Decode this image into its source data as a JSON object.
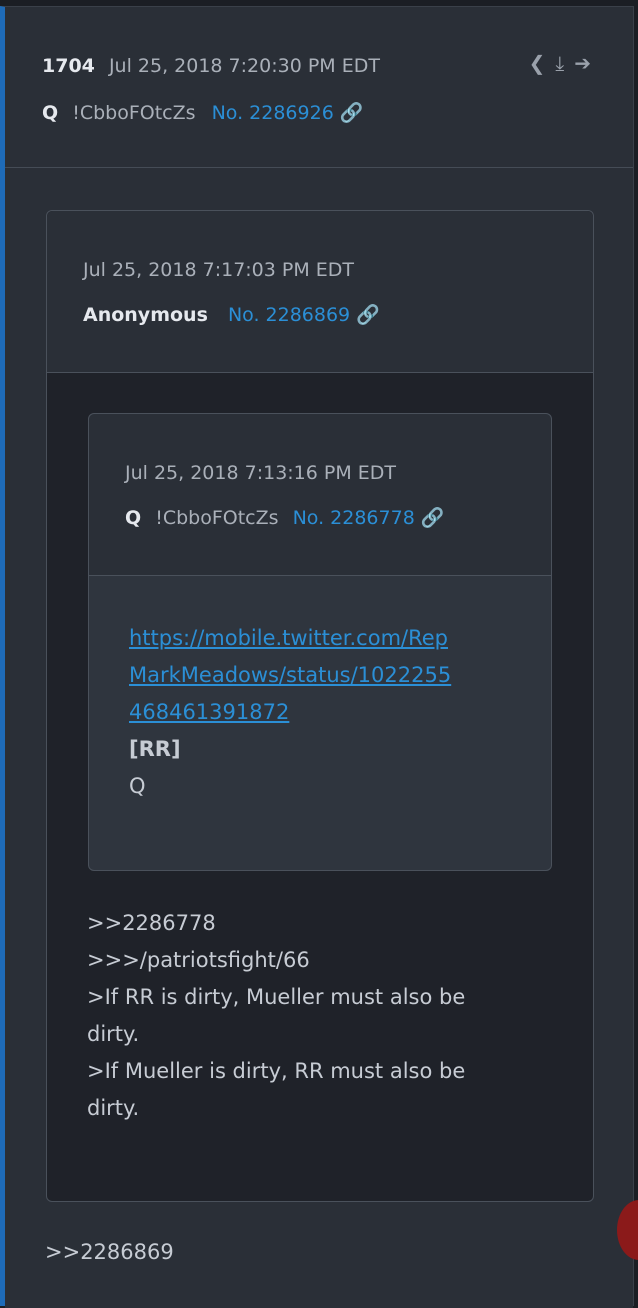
{
  "post": {
    "number": "1704",
    "date": "Jul 25, 2018 7:20:30 PM EDT",
    "name": "Q",
    "tripcode": "!CbboFOtcZs",
    "post_no": "No. 2286926",
    "body_text": ">>2286869"
  },
  "quote1": {
    "date": "Jul 25, 2018 7:17:03 PM EDT",
    "name": "Anonymous",
    "post_no": "No. 2286869",
    "lines": [
      ">>2286778",
      ">>>/patriotsfight/66",
      ">If RR is dirty, Mueller must also be",
      "dirty.",
      ">If Mueller is dirty, RR must also be",
      "dirty."
    ]
  },
  "quote2": {
    "date": "Jul 25, 2018 7:13:16 PM EDT",
    "name": "Q",
    "tripcode": "!CbboFOtcZs",
    "post_no": "No. 2286778",
    "url_lines": [
      "https://mobile.twitter.com/Rep",
      "MarkMeadows/status/1022255",
      "468461391872"
    ],
    "bold_line": "[RR]",
    "sign": "Q"
  },
  "icons": [
    "share-icon",
    "download-icon",
    "arrow-right-circle-icon",
    "link-icon"
  ]
}
